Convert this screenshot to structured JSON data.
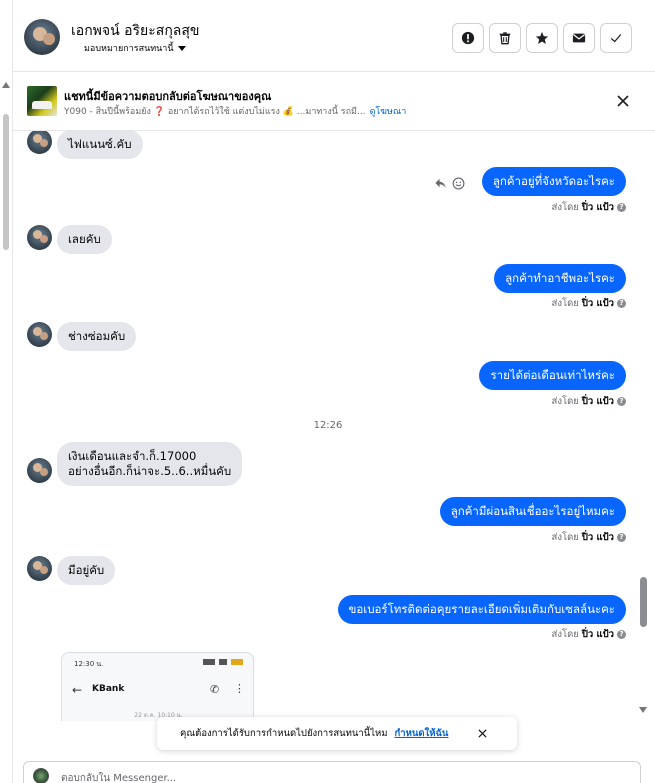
{
  "header": {
    "name": "เอกพจน์ อริยะสกุลสุข",
    "assign_label": "มอบหมายการสนทนานี้",
    "buttons": [
      "mark-spam",
      "delete",
      "star",
      "mark-unread",
      "mark-done"
    ]
  },
  "ad": {
    "title": "แชทนี้มีข้อความตอบกลับต่อโฆษณาของคุณ",
    "description": "Y090 - สินปีนี้พร้อมยัง ❓ อยากได้รถไว้ใช้ แต่งบไม่แรง 💰 ...มาทางนี้ รถมี...",
    "link": "ดูโฆษณา"
  },
  "messages": [
    {
      "dir": "in",
      "text": "ไฟแนนซ์.คับ"
    },
    {
      "dir": "out",
      "text": "ลูกค้าอยู่ที่จังหวัดอะไรคะ",
      "sent_by_prefix": "ส่งโดย",
      "sent_by": "ปิ่ว แป้ว"
    },
    {
      "dir": "in",
      "text": "เลยคับ"
    },
    {
      "dir": "out",
      "text": "ลูกค้าทำอาชีพอะไรคะ",
      "sent_by_prefix": "ส่งโดย",
      "sent_by": "ปิ่ว แป้ว"
    },
    {
      "dir": "in",
      "text": "ช่างซ่อมคับ"
    },
    {
      "dir": "out",
      "text": "รายได้ต่อเดือนเท่าไหร่คะ",
      "sent_by_prefix": "ส่งโดย",
      "sent_by": "ปิ่ว แป้ว"
    },
    {
      "dir": "time",
      "text": "12:26"
    },
    {
      "dir": "in",
      "text_line1": "เงินเดือนและจำ.ก็.17000",
      "text_line2": "อย่างอื่นอีก.ก็น่าจะ.5..6..หมื่นคับ"
    },
    {
      "dir": "out",
      "text": "ลูกค้ามีผ่อนสินเชื่ออะไรอยู่ไหมคะ",
      "sent_by_prefix": "ส่งโดย",
      "sent_by": "ปิ่ว แป้ว"
    },
    {
      "dir": "in",
      "text": "มีอยู่คับ"
    },
    {
      "dir": "out",
      "text": "ขอเบอร์โทรติดต่อคุยรายละเอียดเพิ่มเติมกับเซลล์นะคะ",
      "sent_by_prefix": "ส่งโดย",
      "sent_by": "ปิ่ว แป้ว"
    }
  ],
  "attachment": {
    "status_time": "12:30 น.",
    "app_title": "KBank",
    "date_text": "22 ต.ค. 10:10 น."
  },
  "toast": {
    "text": "คุณต้องการได้รับการกำหนดไปยังการสนทนานี้ไหม",
    "link": "กำหนดให้ฉัน"
  },
  "composer": {
    "placeholder": "ตอบกลับใน Messenger..."
  },
  "colors": {
    "outgoing_bubble": "#0866ff",
    "incoming_bubble": "#e4e6eb",
    "link": "#0064d1"
  }
}
